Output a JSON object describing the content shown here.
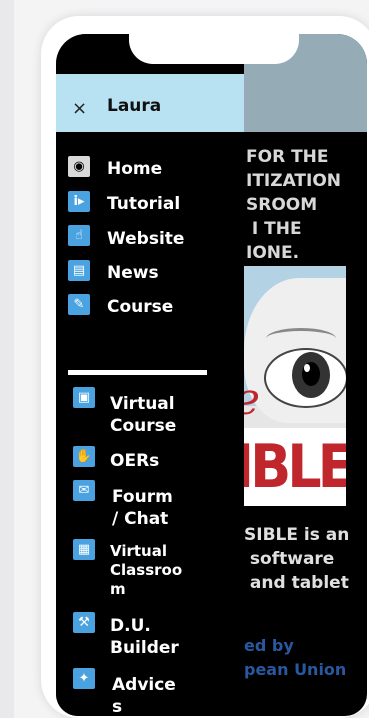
{
  "drawer": {
    "close_icon": "×",
    "user_name": "Laura",
    "items_top": [
      {
        "label": "Home",
        "icon": "eye-icon",
        "glyph": "◉"
      },
      {
        "label": "Tutorial",
        "icon": "info-play-icon",
        "glyph": "i▸"
      },
      {
        "label": "Website",
        "icon": "pointer-icon",
        "glyph": "☝"
      },
      {
        "label": "News",
        "icon": "news-icon",
        "glyph": "▤"
      },
      {
        "label": "Course",
        "icon": "course-icon",
        "glyph": "✎"
      }
    ],
    "items_bottom": [
      {
        "label": "Virtual\nCourse",
        "icon": "folder-icon",
        "glyph": "▣"
      },
      {
        "label": "OERs",
        "icon": "hand-icon",
        "glyph": "✋"
      },
      {
        "label": "Fourm\n/ Chat",
        "icon": "chat-icon",
        "glyph": "✉"
      },
      {
        "label": "Virtual\nClassroo\nm",
        "icon": "classroom-icon",
        "glyph": "▦"
      },
      {
        "label": "D.U.\nBuilder",
        "icon": "builder-icon",
        "glyph": "⚒"
      },
      {
        "label": "Advice\ns",
        "icon": "lightbulb-icon",
        "glyph": "✦"
      }
    ]
  },
  "background": {
    "heading": "FOR THE\nITIZATION\nSROOM\n I THE\nIONE.",
    "poster_text": "IBLE",
    "desc": "SIBLE is an\n software\n and tablet",
    "funding": "ed by\npean Union"
  }
}
